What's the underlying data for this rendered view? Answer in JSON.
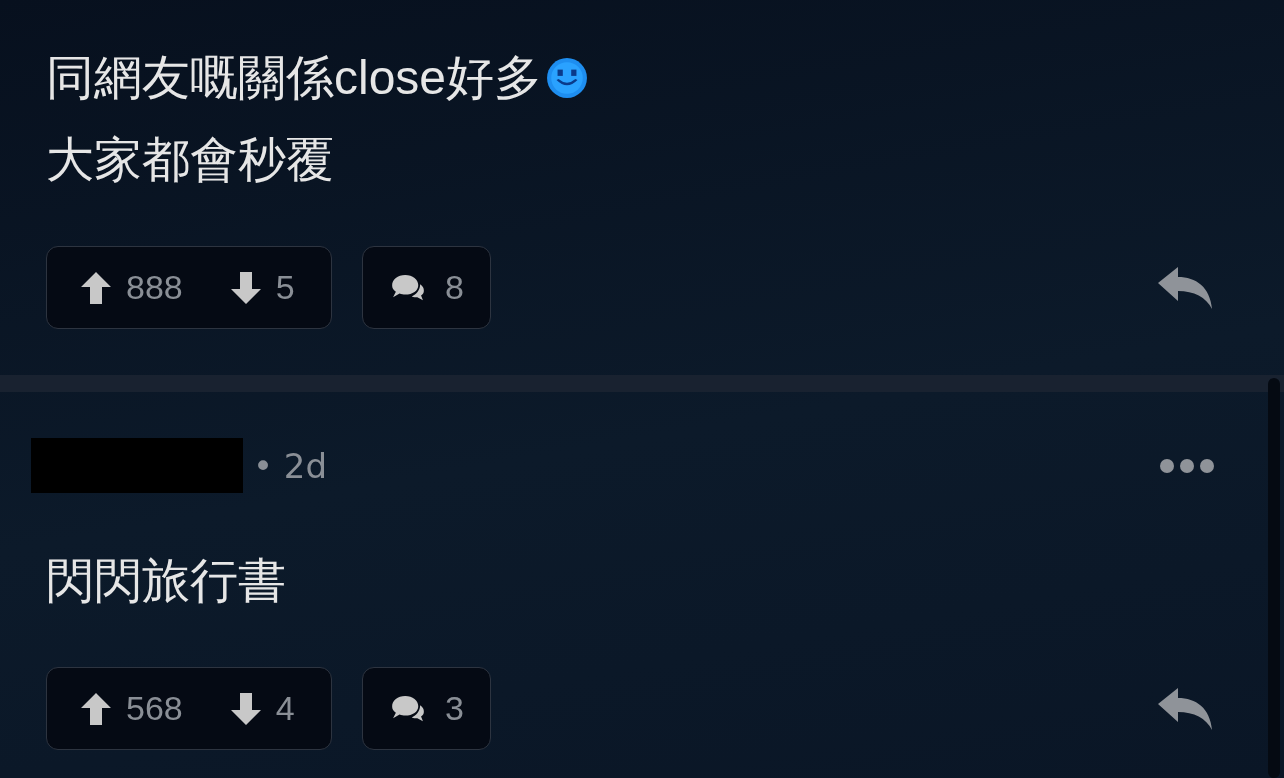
{
  "comments": [
    {
      "lines": [
        {
          "text": "同網友嘅關係close好多",
          "kind": "emoji"
        },
        {
          "text": "大家都會秒覆",
          "kind": "plain"
        }
      ],
      "upvotes": "888",
      "downvotes": "5",
      "replies": "8"
    },
    {
      "header": {
        "time": "• 2d"
      },
      "lines": [
        {
          "text": "閃閃旅行書",
          "kind": "plain"
        }
      ],
      "upvotes": "568",
      "downvotes": "4",
      "replies": "3"
    }
  ]
}
